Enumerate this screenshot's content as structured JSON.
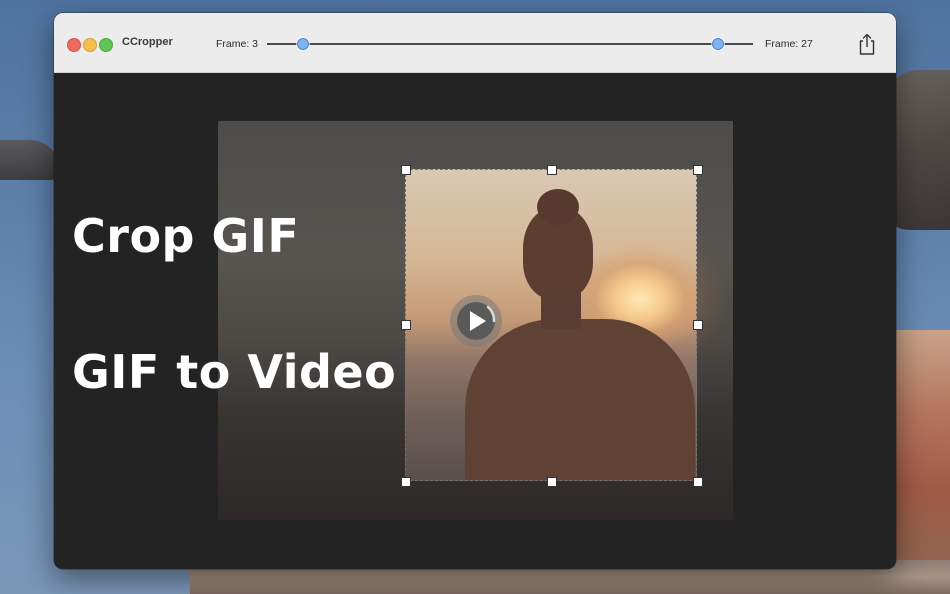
{
  "window": {
    "app_title": "CCropper"
  },
  "toolbar": {
    "frame_start_label": "Frame: 3",
    "frame_end_label": "Frame: 27",
    "frame_start_value": 3,
    "frame_end_value": 27,
    "share_icon": "share-icon"
  },
  "preview": {
    "play_icon": "play-icon"
  },
  "promo": {
    "line1": "Crop GIF",
    "line2": "GIF to Video"
  },
  "colors": {
    "slider_knob": "#7fb2f0",
    "close": "#ed6a5e",
    "minimize": "#f5be4f",
    "maximize": "#61c454"
  }
}
